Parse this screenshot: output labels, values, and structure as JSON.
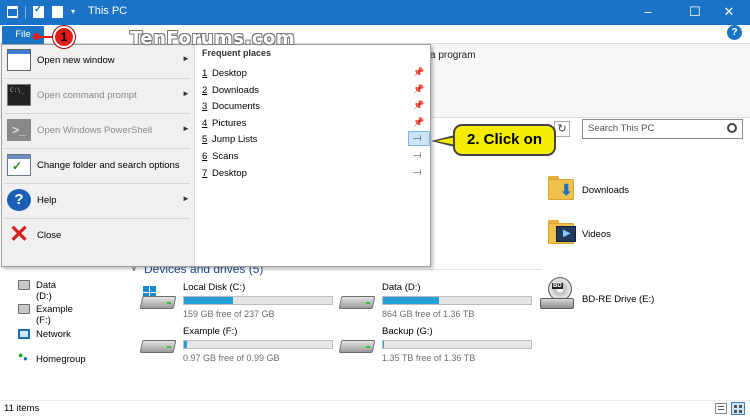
{
  "window": {
    "title": "This PC",
    "minimize_glyph": "–",
    "maximize_glyph": "☐",
    "close_glyph": "✕"
  },
  "ribbon": {
    "file_tab": "File",
    "help_glyph": "?",
    "partial_label": "a program"
  },
  "watermark": "TenForums.com",
  "file_menu": {
    "items": [
      {
        "label": "Open new window",
        "icon": "window-icon",
        "has_submenu": true,
        "enabled": true
      },
      {
        "label": "Open command prompt",
        "icon": "command-prompt-icon",
        "has_submenu": true,
        "enabled": false
      },
      {
        "label": "Open Windows PowerShell",
        "icon": "powershell-icon",
        "has_submenu": true,
        "enabled": false
      },
      {
        "label": "Change folder and search options",
        "icon": "folder-options-icon",
        "has_submenu": false,
        "enabled": true
      },
      {
        "label": "Help",
        "icon": "help-icon",
        "has_submenu": true,
        "enabled": true
      },
      {
        "label": "Close",
        "icon": "close-icon",
        "has_submenu": false,
        "enabled": true
      }
    ],
    "submenu_arrow": "►",
    "cmd_glyph": "C:\\_",
    "ps_glyph": ">_",
    "help_glyph": "?",
    "close_glyph": "✕",
    "frequent_places": {
      "header": "Frequent places",
      "items": [
        {
          "num": "1",
          "name": "Desktop",
          "pinned": true
        },
        {
          "num": "2",
          "name": "Downloads",
          "pinned": true
        },
        {
          "num": "3",
          "name": "Documents",
          "pinned": true
        },
        {
          "num": "4",
          "name": "Pictures",
          "pinned": true
        },
        {
          "num": "5",
          "name": "Jump Lists",
          "pinned": false,
          "highlighted": true
        },
        {
          "num": "6",
          "name": "Scans",
          "pinned": false
        },
        {
          "num": "7",
          "name": "Desktop",
          "pinned": false
        }
      ],
      "pin_glyph": "📌",
      "unpinned_glyph": "-⊣"
    }
  },
  "callouts": {
    "step1": "1",
    "step2": "2. Click on"
  },
  "address": {
    "refresh_glyph": "↻",
    "search_placeholder": "Search This PC"
  },
  "folders": [
    {
      "name": "Downloads"
    },
    {
      "name": "Videos"
    }
  ],
  "section": {
    "arrow": "∨",
    "header": "Devices and drives (5)"
  },
  "drives": [
    {
      "name": "Local Disk (C:)",
      "free_text": "159 GB free of 237 GB",
      "used_fraction": 0.33,
      "system": true
    },
    {
      "name": "Data (D:)",
      "free_text": "864 GB free of 1.36 TB",
      "used_fraction": 0.38,
      "system": false
    },
    {
      "name": "Example (F:)",
      "free_text": "0.97 GB free of 0.99 GB",
      "used_fraction": 0.02,
      "system": false
    },
    {
      "name": "Backup (G:)",
      "free_text": "1.35 TB free of 1.36 TB",
      "used_fraction": 0.01,
      "system": false
    }
  ],
  "bd_drive": {
    "name": "BD-RE Drive (E:)",
    "disc_label": "BD"
  },
  "nav": {
    "items": [
      {
        "label": "Data (D:)",
        "icon": "drive-icon"
      },
      {
        "label": "Example (F:)",
        "icon": "drive-icon"
      },
      {
        "label": "Network",
        "icon": "network-icon"
      },
      {
        "label": "Homegroup",
        "icon": "homegroup-icon"
      }
    ]
  },
  "status": {
    "items_text": "11 items"
  },
  "colors": {
    "accent": "#1a73c6",
    "callout_yellow": "#f5ec00",
    "callout_red": "#e21b1b",
    "drive_bar": "#26a0da"
  }
}
